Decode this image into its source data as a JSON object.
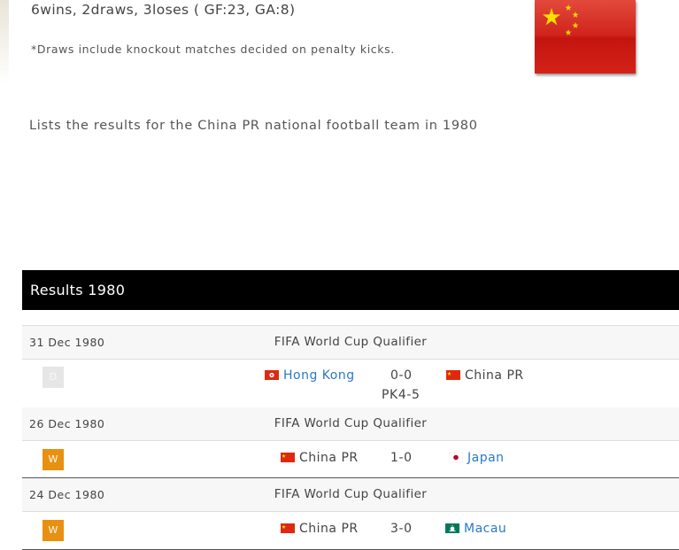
{
  "summary": "6wins, 2draws, 3loses ( GF:23, GA:8)",
  "note": "*Draws include knockout matches decided on penalty kicks.",
  "lead": "Lists the results for the China PR national football team in 1980",
  "results": {
    "title": "Results 1980",
    "matches": [
      {
        "date": "31 Dec 1980",
        "competition": "FIFA World Cup Qualifier",
        "result": "D",
        "home": "Hong Kong",
        "score": "0-0",
        "away": "China PR",
        "penalties": "PK4-5"
      },
      {
        "date": "26 Dec 1980",
        "competition": "FIFA World Cup Qualifier",
        "result": "W",
        "home": "China PR",
        "score": "1-0",
        "away": "Japan"
      },
      {
        "date": "24 Dec 1980",
        "competition": "FIFA World Cup Qualifier",
        "result": "W",
        "home": "China PR",
        "score": "3-0",
        "away": "Macau"
      }
    ]
  },
  "icons": {
    "hero_flag": "china-flag-icon",
    "hong_kong": "hong-kong-flag-icon",
    "china": "china-flag-icon",
    "japan": "japan-flag-icon",
    "macau": "macau-flag-icon"
  },
  "colors": {
    "header_bg": "#000000",
    "link": "#2a79c6",
    "win_badge": "#e8900f",
    "draw_badge": "#e6e6e6",
    "china_red": "#d0231b",
    "star_yellow": "#ffde00"
  }
}
